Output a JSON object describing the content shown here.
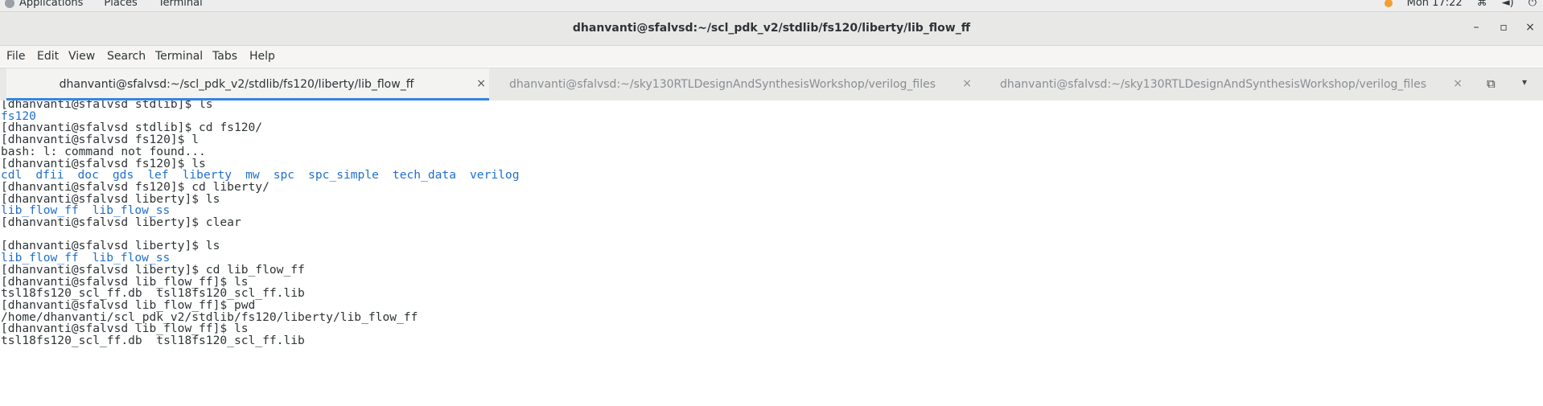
{
  "topbar": {
    "applications": "Applications",
    "places": "Places",
    "terminal": "Terminal",
    "clock": "Mon 17:22",
    "icons": [
      "network-icon",
      "volume-icon",
      "power-icon"
    ]
  },
  "window": {
    "title": "dhanvanti@sfalvsd:~/scl_pdk_v2/stdlib/fs120/liberty/lib_flow_ff",
    "minimize": "–",
    "maximize": "▫",
    "close": "×"
  },
  "menubar": [
    "File",
    "Edit",
    "View",
    "Search",
    "Terminal",
    "Tabs",
    "Help"
  ],
  "tabs": [
    {
      "label": "dhanvanti@sfalvsd:~/scl_pdk_v2/stdlib/fs120/liberty/lib_flow_ff",
      "active": true
    },
    {
      "label": "dhanvanti@sfalvsd:~/sky130RTLDesignAndSynthesisWorkshop/verilog_files",
      "active": false
    },
    {
      "label": "dhanvanti@sfalvsd:~/sky130RTLDesignAndSynthesisWorkshop/verilog_files",
      "active": false
    }
  ],
  "tab_close": "×",
  "new_tab_icon": "⧉",
  "tab_menu_icon": "▾",
  "terminal": {
    "lines": [
      "[dhanvanti@sfalvsd stdlib]$ ls",
      "",
      "[dhanvanti@sfalvsd stdlib]$ cd fs120/",
      "[dhanvanti@sfalvsd fs120]$ l",
      "bash: l: command not found...",
      "[dhanvanti@sfalvsd fs120]$ ls",
      "",
      "[dhanvanti@sfalvsd fs120]$ cd liberty/",
      "[dhanvanti@sfalvsd liberty]$ ls",
      "",
      "[dhanvanti@sfalvsd liberty]$ clear",
      "",
      "[dhanvanti@sfalvsd liberty]$ ls",
      "",
      "[dhanvanti@sfalvsd liberty]$ cd lib_flow_ff",
      "[dhanvanti@sfalvsd lib_flow_ff]$ ls",
      "tsl18fs120_scl_ff.db  tsl18fs120_scl_ff.lib",
      "[dhanvanti@sfalvsd lib_flow_ff]$ pwd",
      "/home/dhanvanti/scl_pdk_v2/stdlib/fs120/liberty/lib_flow_ff",
      "[dhanvanti@sfalvsd lib_flow_ff]$ ls",
      "tsl18fs120_scl_ff.db  tsl18fs120_scl_ff.lib"
    ],
    "dir_lines": {
      "1": [
        "fs120"
      ],
      "6": [
        "cdl",
        "dfii",
        "doc",
        "gds",
        "lef",
        "liberty",
        "mw",
        "spc",
        "spc_simple",
        "tech_data",
        "verilog"
      ],
      "9": [
        "lib_flow_ff",
        "lib_flow_ss"
      ],
      "13": [
        "lib_flow_ff",
        "lib_flow_ss"
      ]
    },
    "colors": {
      "text": "#2e3436",
      "directory": "#1f6fd0"
    }
  }
}
